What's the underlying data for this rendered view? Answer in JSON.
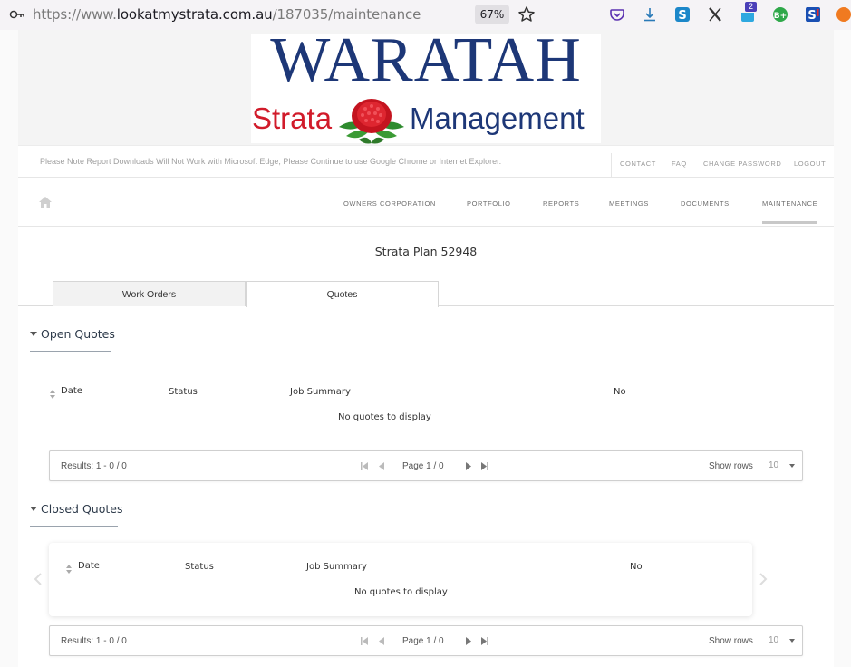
{
  "browser": {
    "url_prefix": "https://www.",
    "url_domain": "lookatmystrata.com.au",
    "url_path": "/187035/maintenance",
    "zoom": "67%",
    "extension_badge": "2"
  },
  "logo": {
    "title": "WARATAH",
    "strata": "Strata",
    "management": "Management"
  },
  "header": {
    "notice": "Please Note Report Downloads Will Not Work with Microsoft Edge, Please Continue to use Google Chrome or Internet Explorer.",
    "links": {
      "contact": "CONTACT",
      "faq": "FAQ",
      "change_password": "CHANGE PASSWORD",
      "logout": "LOGOUT"
    }
  },
  "nav": {
    "owners_corporation": "OWNERS CORPORATION",
    "portfolio": "PORTFOLIO",
    "reports": "REPORTS",
    "meetings": "MEETINGS",
    "documents": "DOCUMENTS",
    "maintenance": "MAINTENANCE"
  },
  "plan_title": "Strata Plan 52948",
  "tabs": {
    "work_orders": "Work Orders",
    "quotes": "Quotes"
  },
  "open_quotes": {
    "title": "Open Quotes",
    "columns": {
      "date": "Date",
      "status": "Status",
      "job_summary": "Job Summary",
      "no": "No"
    },
    "empty": "No quotes to display",
    "pager": {
      "results": "Results: 1 - 0 / 0",
      "page": "Page 1 / 0",
      "show_rows": "Show rows",
      "rows_value": "10"
    }
  },
  "closed_quotes": {
    "title": "Closed Quotes",
    "columns": {
      "date": "Date",
      "status": "Status",
      "job_summary": "Job Summary",
      "no": "No"
    },
    "empty": "No quotes to display",
    "pager": {
      "results": "Results: 1 - 0 / 0",
      "page": "Page 1 / 0",
      "show_rows": "Show rows",
      "rows_value": "10"
    }
  },
  "colors": {
    "logo_blue": "#1d3777",
    "logo_red": "#d11b2a"
  }
}
